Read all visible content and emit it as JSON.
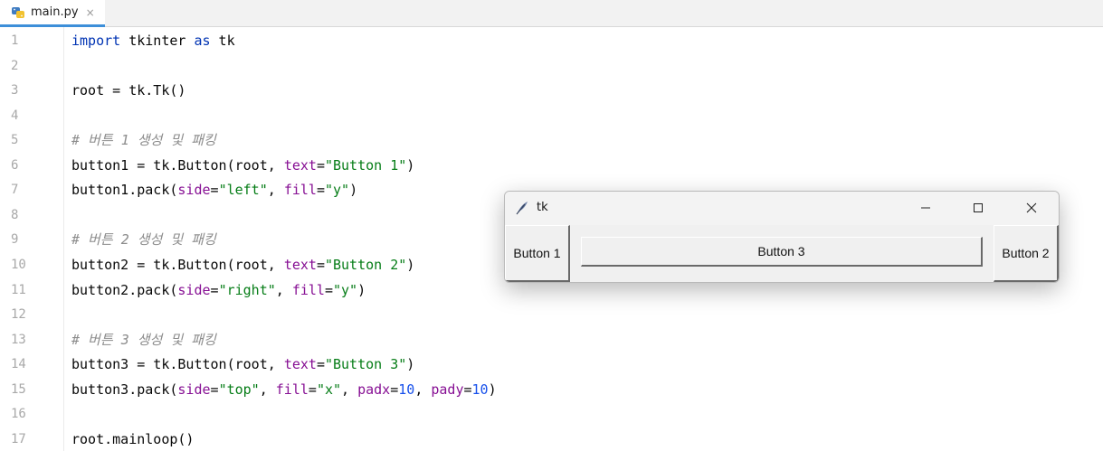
{
  "editor": {
    "tab": {
      "label": "main.py",
      "close": "×"
    },
    "lines": [
      [
        [
          "import",
          "kw"
        ],
        [
          " tkinter ",
          ""
        ],
        [
          "as",
          "kw"
        ],
        [
          " tk",
          ""
        ]
      ],
      [],
      [
        [
          "root = tk.Tk()",
          ""
        ]
      ],
      [],
      [
        [
          "# 버튼 1 생성 및 패킹",
          "cmt"
        ]
      ],
      [
        [
          "button1 = tk.Button(root, ",
          ""
        ],
        [
          "text",
          "kwarg"
        ],
        [
          "=",
          ""
        ],
        [
          "\"Button 1\"",
          "str"
        ],
        [
          ")",
          ""
        ]
      ],
      [
        [
          "button1.pack(",
          ""
        ],
        [
          "side",
          "kwarg"
        ],
        [
          "=",
          ""
        ],
        [
          "\"left\"",
          "str"
        ],
        [
          ", ",
          ""
        ],
        [
          "fill",
          "kwarg"
        ],
        [
          "=",
          ""
        ],
        [
          "\"y\"",
          "str"
        ],
        [
          ")",
          ""
        ]
      ],
      [],
      [
        [
          "# 버튼 2 생성 및 패킹",
          "cmt"
        ]
      ],
      [
        [
          "button2 = tk.Button(root, ",
          ""
        ],
        [
          "text",
          "kwarg"
        ],
        [
          "=",
          ""
        ],
        [
          "\"Button 2\"",
          "str"
        ],
        [
          ")",
          ""
        ]
      ],
      [
        [
          "button2.pack(",
          ""
        ],
        [
          "side",
          "kwarg"
        ],
        [
          "=",
          ""
        ],
        [
          "\"right\"",
          "str"
        ],
        [
          ", ",
          ""
        ],
        [
          "fill",
          "kwarg"
        ],
        [
          "=",
          ""
        ],
        [
          "\"y\"",
          "str"
        ],
        [
          ")",
          ""
        ]
      ],
      [],
      [
        [
          "# 버튼 3 생성 및 패킹",
          "cmt"
        ]
      ],
      [
        [
          "button3 = tk.Button(root, ",
          ""
        ],
        [
          "text",
          "kwarg"
        ],
        [
          "=",
          ""
        ],
        [
          "\"Button 3\"",
          "str"
        ],
        [
          ")",
          ""
        ]
      ],
      [
        [
          "button3.pack(",
          ""
        ],
        [
          "side",
          "kwarg"
        ],
        [
          "=",
          ""
        ],
        [
          "\"top\"",
          "str"
        ],
        [
          ", ",
          ""
        ],
        [
          "fill",
          "kwarg"
        ],
        [
          "=",
          ""
        ],
        [
          "\"x\"",
          "str"
        ],
        [
          ", ",
          ""
        ],
        [
          "padx",
          "kwarg"
        ],
        [
          "=",
          ""
        ],
        [
          "10",
          "num"
        ],
        [
          ", ",
          ""
        ],
        [
          "pady",
          "kwarg"
        ],
        [
          "=",
          ""
        ],
        [
          "10",
          "num"
        ],
        [
          ")",
          ""
        ]
      ],
      [],
      [
        [
          "root.mainloop()",
          ""
        ]
      ]
    ],
    "line_numbers": [
      "1",
      "2",
      "3",
      "4",
      "5",
      "6",
      "7",
      "8",
      "9",
      "10",
      "11",
      "12",
      "13",
      "14",
      "15",
      "16",
      "17"
    ]
  },
  "tk_window": {
    "title": "tk",
    "icon": "feather-icon",
    "controls": {
      "minimize": "minimize-icon",
      "maximize": "maximize-icon",
      "close": "close-icon"
    },
    "buttons": {
      "button1": "Button 1",
      "button2": "Button 2",
      "button3": "Button 3"
    }
  }
}
